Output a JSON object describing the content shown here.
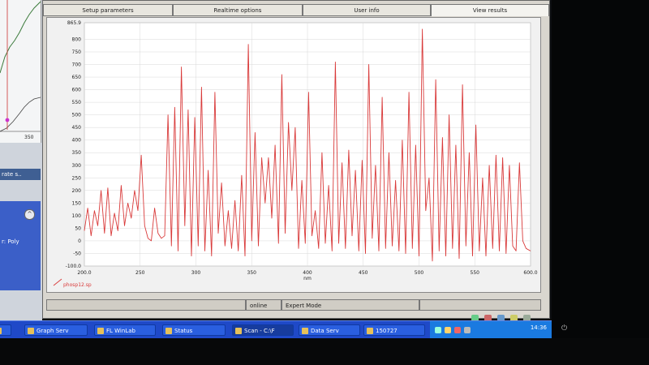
{
  "tabs": [
    {
      "label": "Setup parameters",
      "active": false
    },
    {
      "label": "Realtime options",
      "active": false
    },
    {
      "label": "User info",
      "active": false
    },
    {
      "label": "View results",
      "active": true
    }
  ],
  "left_panel": {
    "mini_tick": "350",
    "strip_text": "rate s..",
    "blue_text": "r: Poly",
    "collapse_glyph": "^"
  },
  "chart_data": {
    "type": "line",
    "xlabel": "nm",
    "xlim": [
      200,
      600
    ],
    "ylim": [
      -100,
      865.9
    ],
    "x_ticks": [
      200,
      250,
      300,
      350,
      400,
      450,
      500,
      550,
      600
    ],
    "x_tick_labels": [
      "200.0",
      "250",
      "300",
      "350",
      "400",
      "450",
      "500",
      "550",
      "600.0"
    ],
    "y_ticks": [
      -100,
      -50,
      0,
      50,
      100,
      150,
      200,
      250,
      300,
      350,
      400,
      450,
      500,
      550,
      600,
      650,
      700,
      750,
      800,
      865.9
    ],
    "y_tick_labels": [
      "-100.0",
      "-50",
      "0",
      "50",
      "100",
      "150",
      "200",
      "250",
      "300",
      "350",
      "400",
      "450",
      "500",
      "550",
      "600",
      "650",
      "700",
      "750",
      "800",
      "865.9"
    ],
    "grid": true,
    "legend": "bottom-left",
    "series": [
      {
        "name": "phosp12.sp",
        "color": "#d93a3a",
        "x": [
          200,
          203,
          206,
          209,
          212,
          215,
          218,
          221,
          224,
          227,
          230,
          233,
          236,
          239,
          242,
          245,
          248,
          251,
          254,
          257,
          260,
          263,
          266,
          269,
          272,
          275,
          278,
          281,
          284,
          287,
          290,
          293,
          296,
          299,
          302,
          305,
          308,
          311,
          314,
          317,
          320,
          323,
          326,
          329,
          332,
          335,
          338,
          341,
          344,
          347,
          350,
          353,
          356,
          359,
          362,
          365,
          368,
          371,
          374,
          377,
          380,
          383,
          386,
          389,
          392,
          395,
          398,
          401,
          404,
          407,
          410,
          413,
          416,
          419,
          422,
          425,
          428,
          431,
          434,
          437,
          440,
          443,
          446,
          449,
          452,
          455,
          458,
          461,
          464,
          467,
          470,
          473,
          476,
          479,
          482,
          485,
          488,
          491,
          494,
          497,
          500,
          503,
          506,
          509,
          512,
          515,
          518,
          521,
          524,
          527,
          530,
          533,
          536,
          539,
          542,
          545,
          548,
          551,
          554,
          557,
          560,
          563,
          566,
          569,
          572,
          575,
          578,
          581,
          584,
          587,
          590,
          593,
          596,
          600
        ],
        "y": [
          40,
          130,
          20,
          120,
          60,
          200,
          30,
          210,
          20,
          110,
          40,
          220,
          60,
          150,
          90,
          200,
          120,
          340,
          60,
          10,
          0,
          130,
          30,
          10,
          20,
          500,
          -20,
          530,
          -40,
          690,
          60,
          520,
          -60,
          490,
          -20,
          610,
          -40,
          280,
          -60,
          590,
          30,
          230,
          -20,
          120,
          -30,
          160,
          -40,
          260,
          -60,
          780,
          0,
          430,
          -20,
          330,
          150,
          330,
          90,
          380,
          -10,
          660,
          30,
          470,
          200,
          450,
          -30,
          240,
          -10,
          590,
          20,
          120,
          -30,
          350,
          -10,
          220,
          -40,
          710,
          -10,
          310,
          -30,
          360,
          20,
          280,
          -40,
          320,
          -50,
          700,
          10,
          300,
          -40,
          570,
          -30,
          350,
          -20,
          240,
          -40,
          400,
          -50,
          590,
          -30,
          380,
          -60,
          840,
          120,
          250,
          -80,
          640,
          -40,
          410,
          -60,
          500,
          -30,
          380,
          -70,
          620,
          -20,
          350,
          -60,
          460,
          -40,
          250,
          -60,
          300,
          -30,
          340,
          -40,
          330,
          -50,
          300,
          -20,
          -40,
          310,
          0,
          -30,
          -40
        ]
      }
    ]
  },
  "status": {
    "cells": [
      "",
      "online",
      "Expert Mode",
      ""
    ]
  },
  "taskbar": {
    "items": [
      {
        "label": "",
        "active": false
      },
      {
        "label": "Graph Serv",
        "active": false
      },
      {
        "label": "FL WinLab",
        "active": false
      },
      {
        "label": "Status",
        "active": false
      },
      {
        "label": "Scan - C:\\F",
        "active": true
      },
      {
        "label": "Data Serv",
        "active": false
      },
      {
        "label": "150727",
        "active": false
      }
    ],
    "clock": "14:36"
  },
  "colors": {
    "plot_line": "#d93a3a",
    "grid": "#d8d8d8",
    "taskbar": "#1f49c8"
  }
}
